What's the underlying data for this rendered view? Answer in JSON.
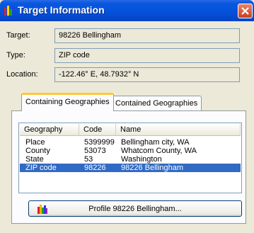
{
  "window": {
    "title": "Target Information",
    "icon": "bar-chart-icon"
  },
  "info": {
    "target_label": "Target:",
    "target_value": "98226  Bellingham",
    "type_label": "Type:",
    "type_value": "ZIP code",
    "location_label": "Location:",
    "location_value": "-122.46° E, 48.7932° N"
  },
  "tabs": [
    {
      "label": "Containing Geographies",
      "active": true
    },
    {
      "label": "Contained Geographies",
      "active": false
    }
  ],
  "list": {
    "columns": [
      "Geography",
      "Code",
      "Name"
    ],
    "rows": [
      {
        "geography": "Place",
        "code": "5399999",
        "name": "Bellingham city, WA",
        "selected": false
      },
      {
        "geography": "County",
        "code": "53073",
        "name": "Whatcom County, WA",
        "selected": false
      },
      {
        "geography": "State",
        "code": "53",
        "name": "Washington",
        "selected": false
      },
      {
        "geography": "ZIP code",
        "code": "98226",
        "name": "98226  Bellingham",
        "selected": true
      }
    ]
  },
  "profile_button": {
    "label": "Profile 98226  Bellingham...",
    "icon": "profile-icon"
  },
  "colors": {
    "titlebar": "#0550d8",
    "selection": "#316ac5",
    "tab_highlight": "#ffc83c"
  }
}
